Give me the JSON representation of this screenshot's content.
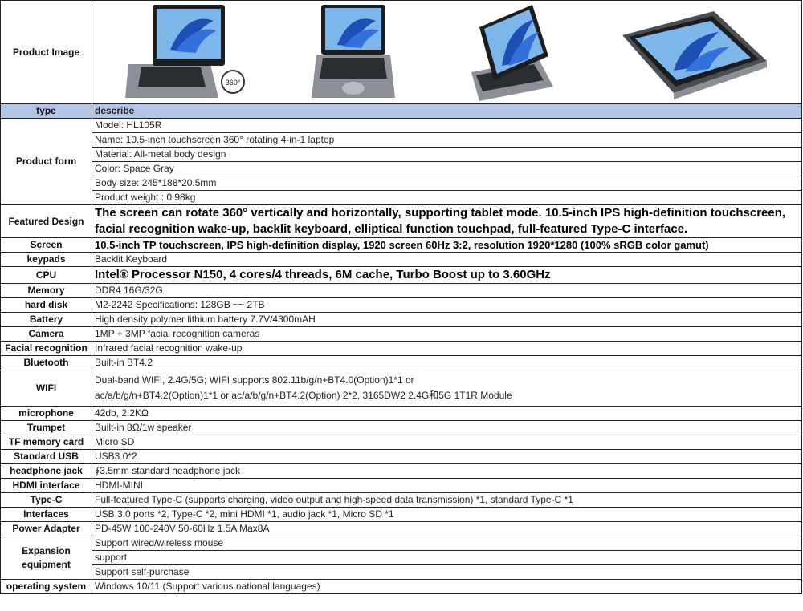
{
  "labels": {
    "product_image": "Product Image",
    "type": "type",
    "product_form": "Product form",
    "featured_design": "Featured Design",
    "screen": "Screen",
    "keypads": "keypads",
    "cpu": "CPU",
    "memory": "Memory",
    "hard_disk": "hard disk",
    "battery": "Battery",
    "camera": "Camera",
    "facial": "Facial recognition",
    "bluetooth": "Bluetooth",
    "wifi": "WIFI",
    "microphone": "microphone",
    "trumpet": "Trumpet",
    "tf": "TF memory card",
    "usb": "Standard USB",
    "headphone": "headphone jack",
    "hdmi": "HDMI interface",
    "typec": "Type-C",
    "interfaces": "Interfaces",
    "power": "Power Adapter",
    "expansion": "Expansion equipment",
    "os": "operating system"
  },
  "values": {
    "describe": "describe",
    "model": "Model:  HL105R",
    "name": "Name: 10.5-inch touchscreen 360° rotating 4-in-1 laptop",
    "material": "Material: All-metal body design",
    "color": "Color: Space Gray",
    "body_size": "Body size:  245*188*20.5mm",
    "weight": "Product weight :  0.98kg",
    "featured": "The screen can rotate 360° vertically and horizontally, supporting tablet mode. 10.5-inch IPS high-definition touchscreen, facial recognition wake-up, backlit keyboard, elliptical function touchpad, full-featured Type-C interface.",
    "screen": "10.5-inch TP touchscreen, IPS high-definition display, 1920 screen 60Hz 3:2, resolution 1920*1280 (100% sRGB color gamut)",
    "keypads": "Backlit Keyboard",
    "cpu": "Intel® Processor N150, 4 cores/4 threads, 6M cache, Turbo Boost up to 3.60GHz",
    "memory": "DDR4 16G/32G",
    "hard_disk": "M2-2242 Specifications: 128GB ~~ 2TB",
    "battery": "High density polymer lithium battery 7.7V/4300mAH",
    "camera": "1MP + 3MP facial recognition cameras",
    "facial": "Infrared facial recognition wake-up",
    "bluetooth": "Built-in BT4.2",
    "wifi_1": "Dual-band WIFI, 2.4G/5G; WIFI supports 802.11b/g/n+BT4.0(Option)1*1 or",
    "wifi_2": "ac/a/b/g/n+BT4.2(Option)1*1 or ac/a/b/g/n+BT4.2(Option) 2*2, 3165DW2 2.4G和5G 1T1R Module",
    "microphone": "42db,  2.2KΩ",
    "trumpet": "Built-in 8Ω/1w speaker",
    "tf": "Micro SD",
    "usb": "USB3.0*2",
    "headphone": "∮3.5mm standard headphone jack",
    "hdmi": "HDMI-MINI",
    "typec": "Full-featured Type-C (supports charging, video output and high-speed data transmission) *1, standard Type-C *1",
    "interfaces": "USB 3.0 ports *2, Type-C *2, mini HDMI *1, audio jack *1, Micro SD *1",
    "power": "PD-45W 100-240V 50-60Hz 1.5A Max8A",
    "exp_1": "Support wired/wireless mouse",
    "exp_2": "support",
    "exp_3": "Support self-purchase",
    "os": "Windows 10/11  (Support various national languages)"
  },
  "images": {
    "badge": "360°",
    "names": [
      "laptop-rotating-icon",
      "laptop-open-icon",
      "laptop-tent-icon",
      "laptop-tablet-icon"
    ]
  }
}
